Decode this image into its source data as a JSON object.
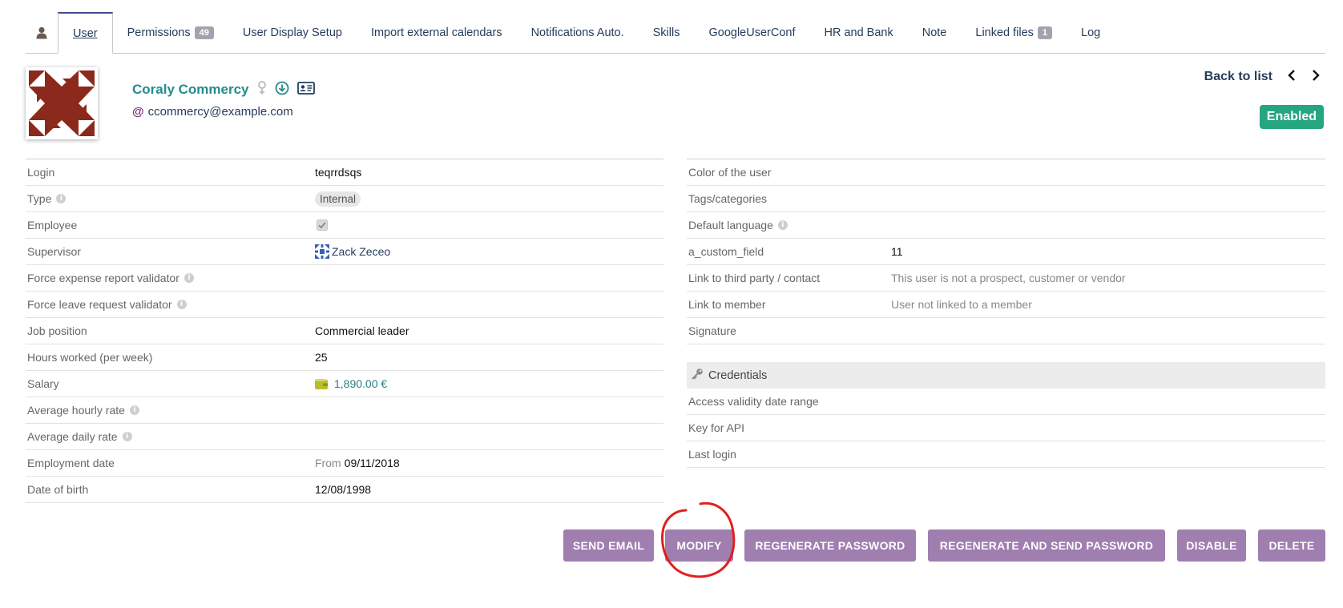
{
  "tabs": [
    {
      "label": "User",
      "active": true
    },
    {
      "label": "Permissions",
      "badge": "49"
    },
    {
      "label": "User Display Setup"
    },
    {
      "label": "Import external calendars"
    },
    {
      "label": "Notifications Auto."
    },
    {
      "label": "Skills"
    },
    {
      "label": "GoogleUserConf"
    },
    {
      "label": "HR and Bank"
    },
    {
      "label": "Note"
    },
    {
      "label": "Linked files",
      "badge": "1"
    },
    {
      "label": "Log"
    }
  ],
  "header": {
    "name": "Coraly Commercy",
    "email_prefix": "@",
    "email": "ccommercy@example.com",
    "back_to_list": "Back to list",
    "status": "Enabled"
  },
  "left_fields": [
    {
      "label": "Login",
      "value": "teqrrdsqs"
    },
    {
      "label": "Type",
      "value": "Internal",
      "info": true
    },
    {
      "label": "Employee",
      "value": "checked"
    },
    {
      "label": "Supervisor",
      "value": "Zack Zeceo"
    },
    {
      "label": "Force expense report validator",
      "value": "",
      "info": true
    },
    {
      "label": "Force leave request validator",
      "value": "",
      "info": true
    },
    {
      "label": "Job position",
      "value": "Commercial leader"
    },
    {
      "label": "Hours worked (per week)",
      "value": "25"
    },
    {
      "label": "Salary",
      "value": "1,890.00 €"
    },
    {
      "label": "Average hourly rate",
      "value": "",
      "info": true
    },
    {
      "label": "Average daily rate",
      "value": "",
      "info": true
    },
    {
      "label": "Employment date",
      "prefix": "From",
      "value": "09/11/2018"
    },
    {
      "label": "Date of birth",
      "value": "12/08/1998"
    }
  ],
  "right_fields": [
    {
      "label": "Color of the user",
      "value": ""
    },
    {
      "label": "Tags/categories",
      "value": ""
    },
    {
      "label": "Default language",
      "value": "",
      "info": true
    },
    {
      "label": "a_custom_field",
      "value": "11"
    },
    {
      "label": "Link to third party / contact",
      "value": "This user is not a prospect, customer or vendor"
    },
    {
      "label": "Link to member",
      "value": "User not linked to a member"
    },
    {
      "label": "Signature",
      "value": ""
    }
  ],
  "credentials": {
    "title": "Credentials",
    "fields": [
      {
        "label": "Access validity date range"
      },
      {
        "label": "Key for API"
      },
      {
        "label": "Last login"
      }
    ]
  },
  "buttons": {
    "send_email": "SEND EMAIL",
    "modify": "MODIFY",
    "regenerate_password": "REGENERATE PASSWORD",
    "regenerate_and_send": "REGENERATE AND SEND PASSWORD",
    "disable": "DISABLE",
    "delete": "DELETE"
  },
  "colors": {
    "accent": "#263c5c",
    "name": "#258b8b",
    "status": "#25a580",
    "button": "#a07eaf",
    "annotation": "#e02020"
  },
  "icons": [
    "user-icon",
    "female-icon",
    "download-icon",
    "vcard-icon",
    "chevron-left-icon",
    "chevron-right-icon",
    "key-icon",
    "wallet-icon"
  ]
}
